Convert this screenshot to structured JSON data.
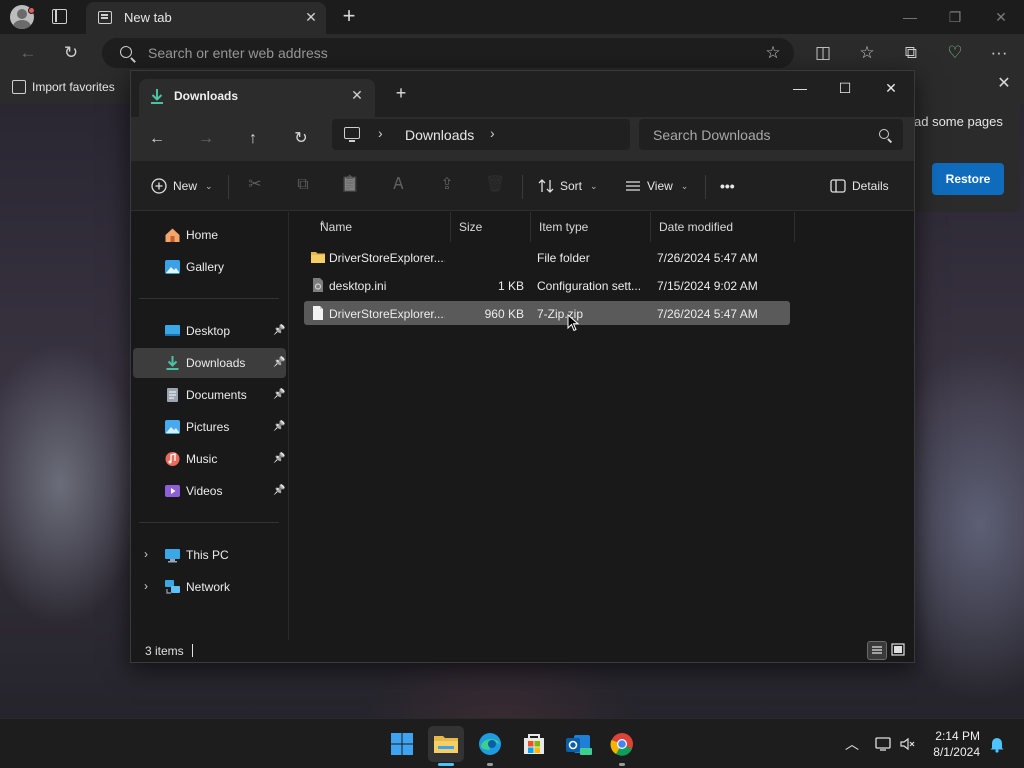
{
  "browser": {
    "tab": {
      "label": "New tab",
      "close": "✕"
    },
    "new_tab": "+",
    "controls": {
      "minimize": "—",
      "maximize": "❐",
      "close": "✕"
    },
    "toolbar": {
      "back": "←",
      "refresh": "↻",
      "address_placeholder": "Search or enter web address",
      "star": "☆",
      "split": "◫",
      "favorites": "☆",
      "collections": "⧉",
      "copilot": "♡",
      "more": "···"
    },
    "favorites_bar": {
      "import": "Import favorites"
    },
    "restore_panel": {
      "text": "ad some pages",
      "button": "Restore",
      "close": "✕"
    }
  },
  "explorer": {
    "tab": {
      "label": "Downloads",
      "close": "✕"
    },
    "new_tab": "+",
    "controls": {
      "minimize": "—",
      "maximize": "☐",
      "close": "✕"
    },
    "nav": {
      "back": "←",
      "forward": "→",
      "up": "↑",
      "refresh": "↻"
    },
    "breadcrumb": {
      "chevron1": "›",
      "location": "Downloads",
      "chevron2": "›"
    },
    "search_placeholder": "Search Downloads",
    "command_bar": {
      "new": "New",
      "cut": "✂",
      "copy": "⧉",
      "paste": "📋",
      "rename": "Ꭺ",
      "share": "⇪",
      "delete": "🗑",
      "sort": "Sort",
      "view": "View",
      "more": "•••",
      "details": "Details"
    },
    "nav_pane": {
      "items": [
        {
          "label": "Home",
          "icon": "home-icon"
        },
        {
          "label": "Gallery",
          "icon": "gallery-icon"
        },
        {
          "label": "Desktop",
          "icon": "desktop-icon",
          "pinned": true
        },
        {
          "label": "Downloads",
          "icon": "downloads-icon",
          "pinned": true,
          "selected": true
        },
        {
          "label": "Documents",
          "icon": "documents-icon",
          "pinned": true
        },
        {
          "label": "Pictures",
          "icon": "pictures-icon",
          "pinned": true
        },
        {
          "label": "Music",
          "icon": "music-icon",
          "pinned": true
        },
        {
          "label": "Videos",
          "icon": "videos-icon",
          "pinned": true
        },
        {
          "label": "This PC",
          "icon": "this-pc-icon"
        },
        {
          "label": "Network",
          "icon": "network-icon"
        }
      ],
      "pin_glyph": "📌",
      "expander": "›"
    },
    "columns": [
      "Name",
      "Size",
      "Item type",
      "Date modified"
    ],
    "sort_caret": "^",
    "files": [
      {
        "name": "DriverStoreExplorer....",
        "size": "",
        "type": "File folder",
        "date": "7/26/2024 5:47 AM",
        "icon": "folder-icon"
      },
      {
        "name": "desktop.ini",
        "size": "1 KB",
        "type": "Configuration sett...",
        "date": "7/15/2024 9:02 AM",
        "icon": "settings-file-icon"
      },
      {
        "name": "DriverStoreExplorer....",
        "size": "960 KB",
        "type": "7-Zip.zip",
        "date": "7/26/2024 5:47 AM",
        "icon": "zip-file-icon",
        "selected": true
      }
    ],
    "status": "3 items"
  },
  "taskbar": {
    "apps": [
      "start-icon",
      "file-explorer-icon",
      "edge-icon",
      "store-icon",
      "outlook-icon",
      "chrome-icon"
    ],
    "tray": {
      "chevron": "︿"
    },
    "clock": {
      "time": "2:14 PM",
      "date": "8/1/2024"
    }
  }
}
